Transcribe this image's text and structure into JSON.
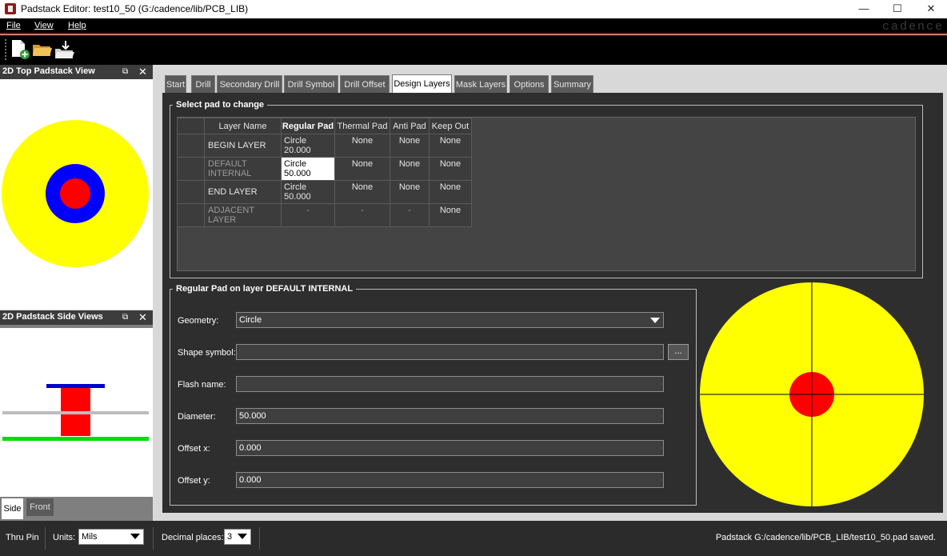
{
  "window": {
    "title": "Padstack Editor: test10_50  (G:/cadence/lib/PCB_LIB)",
    "minimize": "—",
    "maximize": "☐",
    "close": "✕"
  },
  "menu": {
    "file": "File",
    "view": "View",
    "help": "Help",
    "brand": "cadence"
  },
  "toolbar": {
    "icons": [
      "new-file-icon",
      "open-folder-icon",
      "save-icon"
    ]
  },
  "top_view": {
    "title": "2D Top Padstack View",
    "float": "⧉",
    "close": "✕"
  },
  "side_view": {
    "title": "2D Padstack Side Views",
    "float": "⧉",
    "close": "✕",
    "tabs": [
      "Side",
      "Front"
    ]
  },
  "tabs": [
    "Start",
    "Drill",
    "Secondary Drill",
    "Drill Symbol",
    "Drill Offset",
    "Design Layers",
    "Mask Layers",
    "Options",
    "Summary"
  ],
  "active_tab": "Design Layers",
  "select_group": {
    "title": "Select pad to change",
    "headers": [
      "Layer Name",
      "Regular Pad",
      "Thermal Pad",
      "Anti Pad",
      "Keep Out"
    ],
    "rows": [
      {
        "name": "BEGIN LAYER",
        "regular": "Circle 20.000",
        "thermal": "None",
        "anti": "None",
        "keepout": "None"
      },
      {
        "name": "DEFAULT INTERNAL",
        "regular": "Circle 50.000",
        "thermal": "None",
        "anti": "None",
        "keepout": "None"
      },
      {
        "name": "END LAYER",
        "regular": "Circle 50.000",
        "thermal": "None",
        "anti": "None",
        "keepout": "None"
      },
      {
        "name": "ADJACENT LAYER",
        "regular": "-",
        "thermal": "-",
        "anti": "-",
        "keepout": "None"
      }
    ]
  },
  "pad_group": {
    "title": "Regular Pad on layer DEFAULT INTERNAL",
    "geometry_label": "Geometry:",
    "geometry_value": "Circle",
    "shape_label": "Shape symbol:",
    "shape_value": "",
    "browse": "...",
    "flash_label": "Flash name:",
    "flash_value": "",
    "diameter_label": "Diameter:",
    "diameter_value": "50.000",
    "offx_label": "Offset x:",
    "offx_value": "0.000",
    "offy_label": "Offset y:",
    "offy_value": "0.000"
  },
  "status": {
    "pin_type": "Thru Pin",
    "units_label": "Units:",
    "units_value": "Mils",
    "decimal_label": "Decimal places:",
    "decimal_value": "3",
    "message": "Padstack G:/cadence/lib/PCB_LIB/test10_50.pad saved."
  },
  "colors": {
    "pad_outer": "#ffff00",
    "antipad": "#0000ff",
    "drill": "#ff0000",
    "layer_top": "#0000cc",
    "layer_mid": "#bdbdbd",
    "layer_bottom": "#00dd00"
  }
}
